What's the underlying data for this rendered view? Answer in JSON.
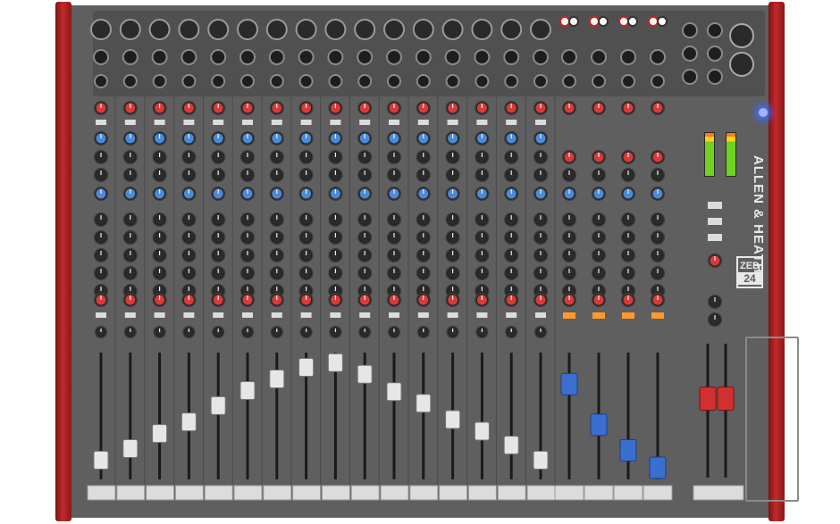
{
  "brand": {
    "name": "ALLEN & HEATH",
    "model_line1": "ZED",
    "model_line2": "24"
  },
  "colors": {
    "chassis": "#5f5f5f",
    "end_cheeks": "#b52222",
    "mono_fader_cap": "#e6e6e6",
    "stereo_fader_cap": "#3a6fd0",
    "master_fader_cap": "#d23030",
    "knob_gain": "#d83a3a",
    "knob_eq": "#4a8ad8",
    "knob_aux": "#2b2b2b",
    "power_led": "#3d6bff"
  },
  "channels": {
    "mono_count": 16,
    "stereo_count": 4,
    "mono_fader_levels": [
      0.15,
      0.25,
      0.38,
      0.48,
      0.62,
      0.75,
      0.85,
      0.95,
      0.99,
      0.89,
      0.74,
      0.64,
      0.5,
      0.4,
      0.28,
      0.15
    ],
    "stereo_fader_levels": [
      0.82,
      0.47,
      0.25,
      0.1
    ],
    "master_fader_level": 0.72
  }
}
